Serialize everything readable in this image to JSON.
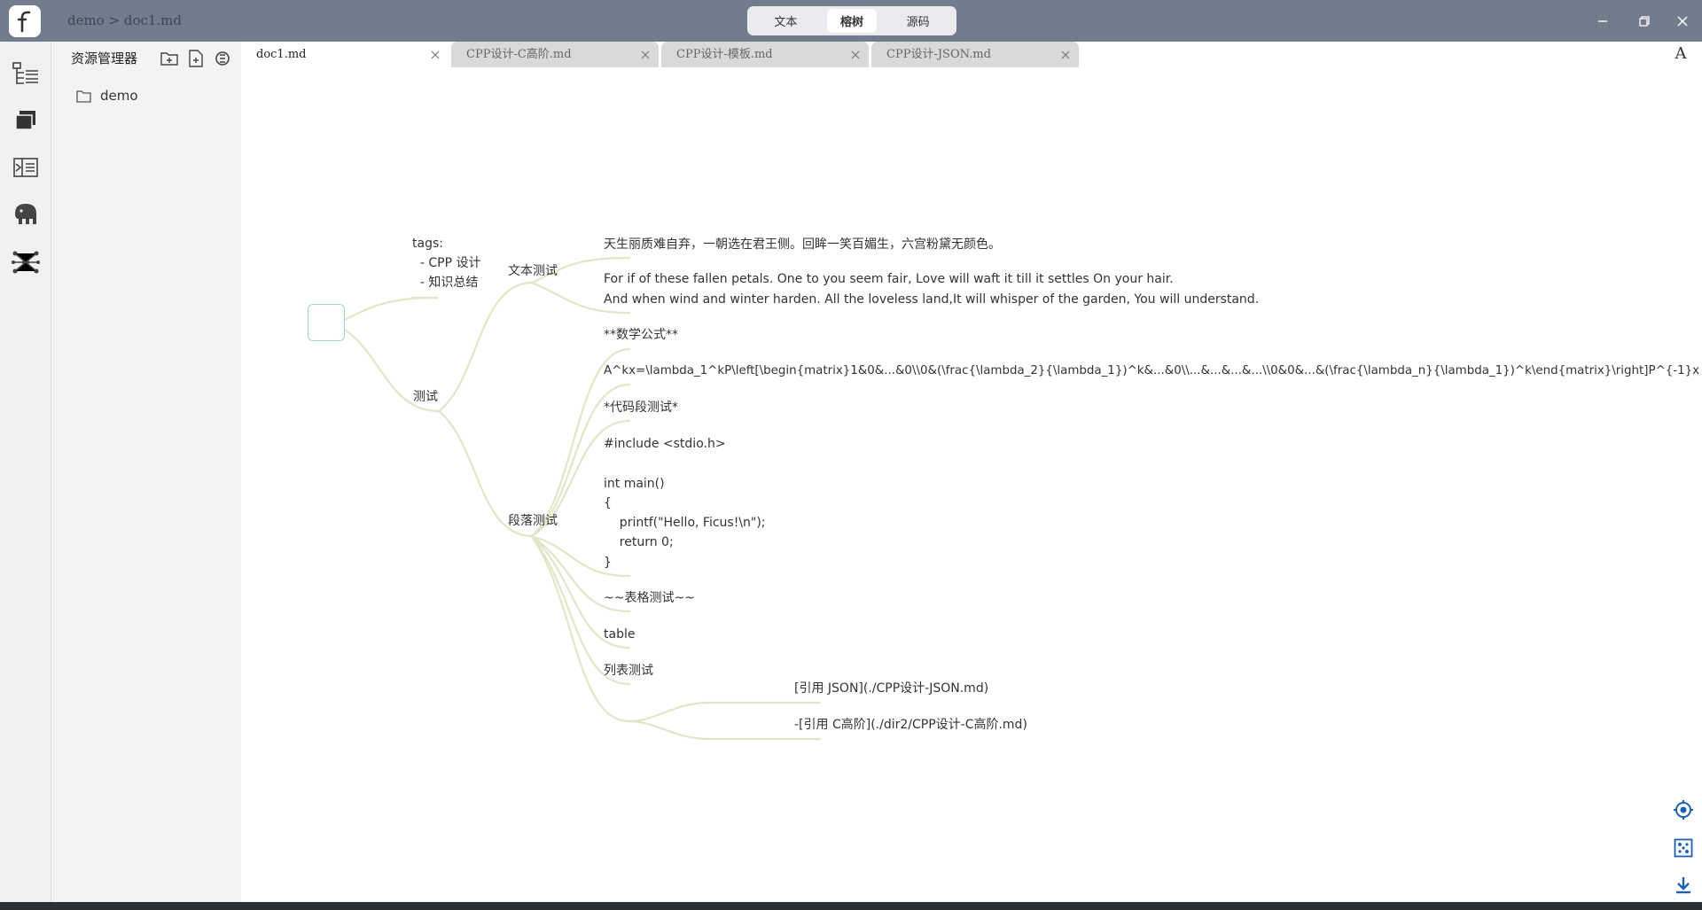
{
  "titlebar": {
    "logo": "F",
    "breadcrumb": "demo > doc1.md",
    "modes": [
      "文本",
      "榕树",
      "源码"
    ],
    "active_mode": "榕树"
  },
  "activity_bar": {
    "icons": [
      "outline-tree-icon",
      "files-icon",
      "preview-icon",
      "elephant-icon",
      "graph-icon"
    ]
  },
  "sidebar": {
    "title": "资源管理器",
    "tools": [
      "new-folder-icon",
      "new-file-icon",
      "locate-icon"
    ],
    "tree": [
      {
        "label": "demo",
        "icon": "folder-icon"
      }
    ]
  },
  "tabs": [
    {
      "label": "doc1.md",
      "active": true
    },
    {
      "label": "CPP设计-C高阶.md",
      "active": false
    },
    {
      "label": "CPP设计-模板.md",
      "active": false
    },
    {
      "label": "CPP设计-JSON.md",
      "active": false
    }
  ],
  "font_button": "A",
  "mindmap": {
    "tags": "tags:\n  - CPP 设计\n  - 知识总结",
    "ceshi": "测试",
    "wenben_ceshi": "文本测试",
    "duanluo_ceshi": "段落测试",
    "poem": "天生丽质难自弃，一朝选在君王侧。回眸一笑百媚生，六宫粉黛无颜色。",
    "english": "For if of these fallen petals. One to you seem fair, Love will waft it till it settles On your hair.\nAnd when wind and winter harden. All the loveless land,It will whisper of the garden, You will understand.",
    "math_title": "**数学公式**",
    "formula": "A^kx=\\lambda_1^kP\\left[\\begin{matrix}1&0&...&0\\\\0&(\\frac{\\lambda_2}{\\lambda_1})^k&...&0\\\\...&...&...&...\\\\0&0&...&(\\frac{\\lambda_n}{\\lambda_1})^k\\end{matrix}\\right]P^{-1}x",
    "code_title": "*代码段测试*",
    "code": "#include <stdio.h>\n\nint main()\n{\n    printf(\"Hello, Ficus!\\n\");\n    return 0;\n}",
    "table_title": "~~表格测试~~",
    "table": "table",
    "list_title": "列表测试",
    "ref1": "[引用 JSON](./CPP设计-JSON.md)",
    "ref2": "-[引用 C高阶](./dir2/CPP设计-C高阶.md)"
  },
  "right_tools": [
    "locate-center-icon",
    "fit-view-icon",
    "download-icon"
  ],
  "colors": {
    "titlebar": "#717c8d",
    "branch": "#dfe6c6",
    "root_border": "#9fd7d3"
  }
}
